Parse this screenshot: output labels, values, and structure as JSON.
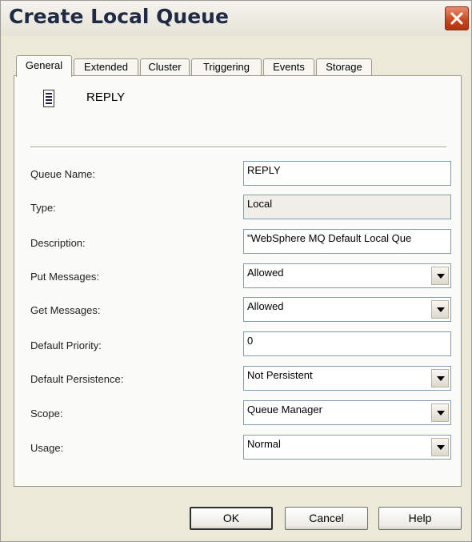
{
  "window": {
    "title": "Create Local Queue"
  },
  "tabs": [
    "General",
    "Extended",
    "Cluster",
    "Triggering",
    "Events",
    "Storage"
  ],
  "active_tab": "General",
  "header": {
    "queue_icon": "queue-icon",
    "name": "REPLY"
  },
  "fields": {
    "queue_name": {
      "label": "Queue Name:",
      "value": "REPLY"
    },
    "type": {
      "label": "Type:",
      "value": "Local"
    },
    "description": {
      "label": "Description:",
      "value": "\"WebSphere MQ Default Local Que"
    },
    "put_messages": {
      "label": "Put Messages:",
      "value": "Allowed"
    },
    "get_messages": {
      "label": "Get Messages:",
      "value": "Allowed"
    },
    "default_priority": {
      "label": "Default Priority:",
      "value": "0"
    },
    "default_persistence": {
      "label": "Default Persistence:",
      "value": "Not Persistent"
    },
    "scope": {
      "label": "Scope:",
      "value": "Queue Manager"
    },
    "usage": {
      "label": "Usage:",
      "value": "Normal"
    }
  },
  "buttons": {
    "ok": "OK",
    "cancel": "Cancel",
    "help": "Help"
  },
  "colors": {
    "close_button": "#c8451d",
    "dialog_bg": "#ece9d8",
    "panel_bg": "#fbfbf8"
  }
}
